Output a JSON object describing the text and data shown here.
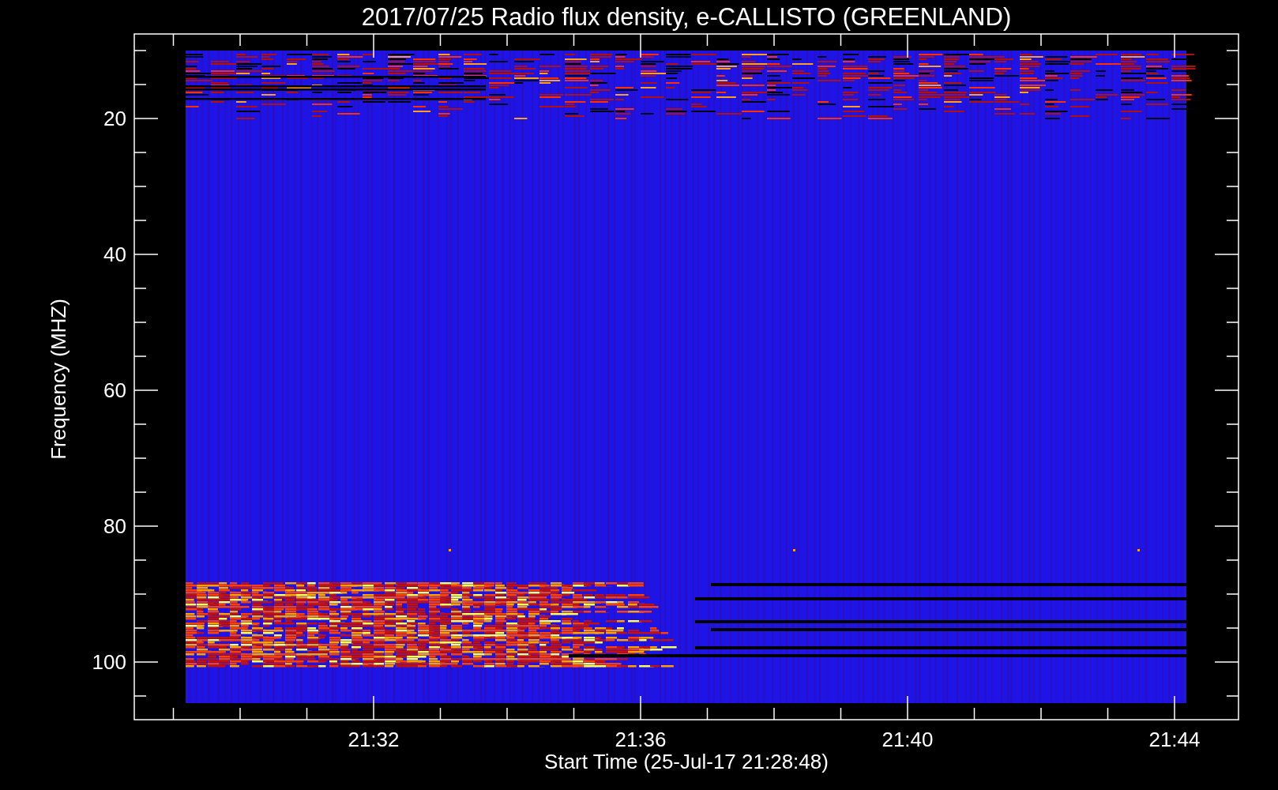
{
  "title": "2017/07/25  Radio flux density, e-CALLISTO (GREENLAND)",
  "y_axis": {
    "label": "Frequency (MHZ)",
    "ticks": [
      "20",
      "40",
      "60",
      "80",
      "100"
    ]
  },
  "x_axis": {
    "label": "Start Time (25-Jul-17 21:28:48)",
    "ticks": [
      "21:32",
      "21:36",
      "21:40",
      "21:44"
    ]
  }
}
